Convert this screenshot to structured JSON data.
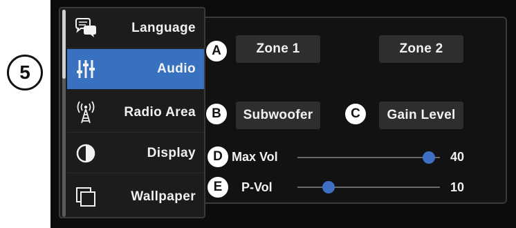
{
  "step_number": "5",
  "sidebar": {
    "items": [
      {
        "label": "Language",
        "icon": "speech-bubbles-icon",
        "active": false
      },
      {
        "label": "Audio",
        "icon": "equalizer-icon",
        "active": true
      },
      {
        "label": "Radio Area",
        "icon": "radio-tower-icon",
        "active": false
      },
      {
        "label": "Display",
        "icon": "contrast-icon",
        "active": false
      },
      {
        "label": "Wallpaper",
        "icon": "wallpaper-icon",
        "active": false
      }
    ]
  },
  "callouts": {
    "a": "A",
    "b": "B",
    "c": "C",
    "d": "D",
    "e": "E"
  },
  "buttons": {
    "zone1": "Zone 1",
    "zone2": "Zone 2",
    "subwoofer": "Subwoofer",
    "gain_level": "Gain Level"
  },
  "sliders": {
    "max_vol": {
      "label": "Max Vol",
      "value": "40",
      "fraction": 0.92
    },
    "p_vol": {
      "label": "P-Vol",
      "value": "10",
      "fraction": 0.22
    }
  },
  "colors": {
    "accent": "#3871c0",
    "knob": "#3d6fc4",
    "background": "#0c0c0c",
    "button": "#2e2e2e"
  }
}
